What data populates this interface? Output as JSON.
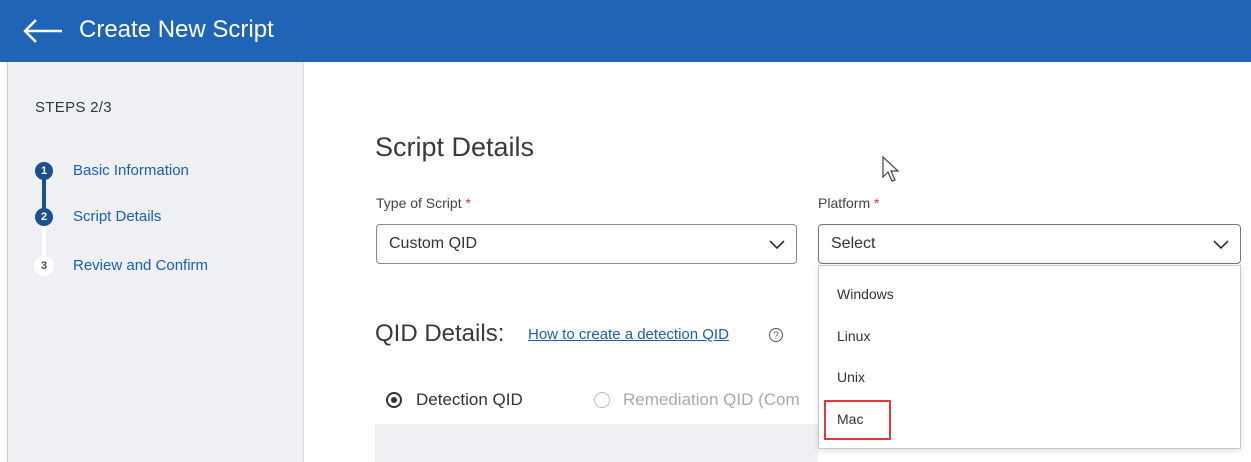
{
  "header": {
    "title": "Create New Script",
    "back_icon": "arrow-left-icon"
  },
  "sidebar": {
    "steps_label": "STEPS 2/3",
    "steps": [
      {
        "num": "1",
        "label": "Basic Information",
        "state": "done"
      },
      {
        "num": "2",
        "label": "Script Details",
        "state": "current"
      },
      {
        "num": "3",
        "label": "Review and Confirm",
        "state": "pending"
      }
    ]
  },
  "main": {
    "section_title": "Script Details",
    "type_of_script": {
      "label": "Type of Script",
      "required_mark": "*",
      "value": "Custom QID"
    },
    "platform": {
      "label": "Platform",
      "required_mark": "*",
      "value": "Select",
      "options": [
        "Windows",
        "Linux",
        "Unix",
        "Mac"
      ],
      "highlighted_option": "Mac"
    },
    "qid": {
      "title": "QID Details:",
      "link": "How to create a detection QID",
      "radio_detection": "Detection QID",
      "radio_remediation": "Remediation QID (Com"
    }
  },
  "colors": {
    "header": "#1f64b5",
    "accent": "#1c4f8f",
    "highlight": "#e0383b"
  }
}
